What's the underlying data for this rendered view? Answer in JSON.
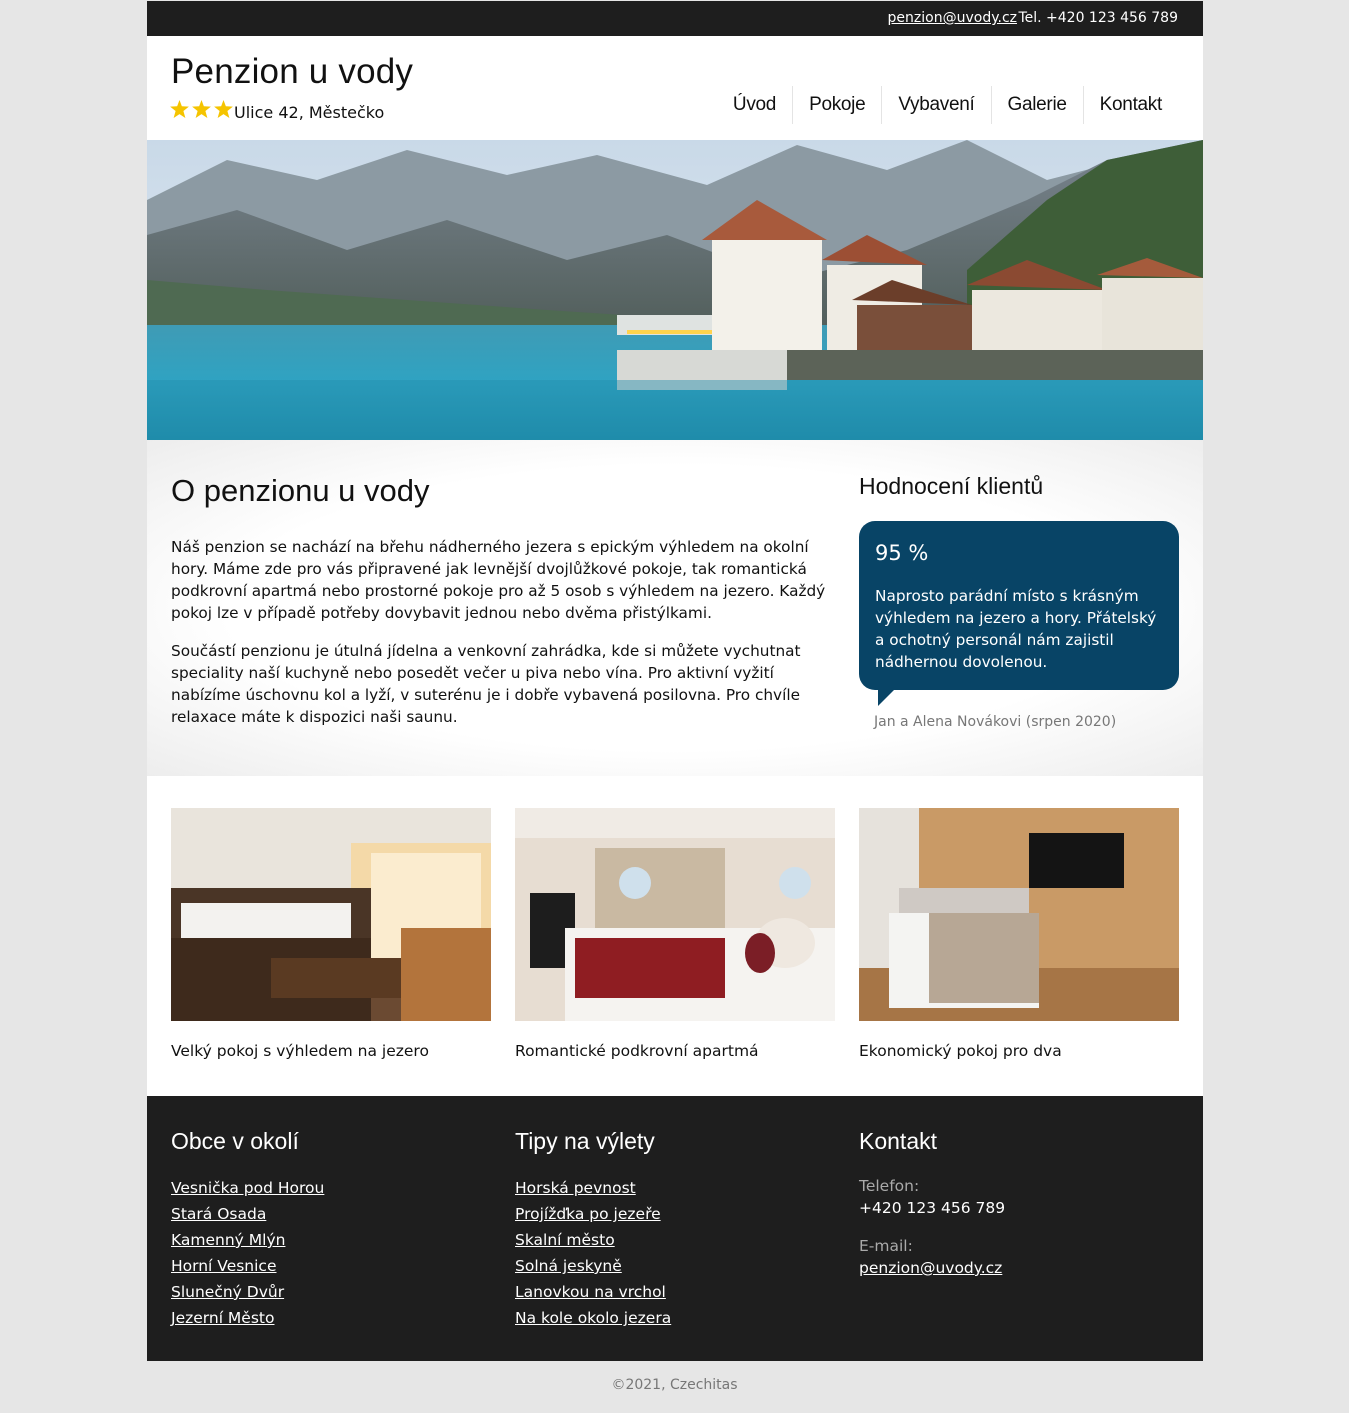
{
  "topbar": {
    "email": "penzion@uvody.cz",
    "phone": "Tel. +420 123 456 789"
  },
  "header": {
    "title": "Penzion u vody",
    "stars": 3,
    "address": "Ulice 42, Městečko"
  },
  "nav": {
    "items": [
      "Úvod",
      "Pokoje",
      "Vybavení",
      "Galerie",
      "Kontakt"
    ]
  },
  "about": {
    "heading": "O penzionu u vody",
    "paragraph1": "Náš penzion se nachází na břehu nádherného jezera s epickým výhledem na okolní hory. Máme zde pro vás připravené jak levnější dvojlůžkové pokoje, tak romantická podkrovní apartmá nebo prostorné pokoje pro až 5 osob s výhledem na jezero. Každý pokoj lze v případě potřeby dovybavit jednou nebo dvěma přistýlkami.",
    "paragraph2": "Součástí penzionu je útulná jídelna a venkovní zahrádka, kde si můžete vychutnat speciality naší kuchyně nebo posedět večer u piva nebo vína. Pro aktivní vyžití nabízíme úschovnu kol a lyží, v suterénu je i dobře vybavená posilovna. Pro chvíle relaxace máte k dispozici naši saunu."
  },
  "reviews": {
    "heading": "Hodnocení klientů",
    "score": "95 %",
    "text": "Naprosto parádní místo s krásným výhledem na jezero a hory. Přátelský a ochotný personál nám zajistil nádhernou dovolenou.",
    "author": "Jan a Alena Novákovi (srpen 2020)"
  },
  "rooms": [
    {
      "caption": "Velký pokoj s výhledem na jezero"
    },
    {
      "caption": "Romantické podkrovní apartmá"
    },
    {
      "caption": "Ekonomický pokoj pro dva"
    }
  ],
  "footer": {
    "villages": {
      "heading": "Obce v okolí",
      "links": [
        "Vesnička pod Horou",
        "Stará Osada",
        "Kamenný Mlýn",
        "Horní Vesnice",
        "Slunečný Dvůr",
        "Jezerní Město"
      ]
    },
    "trips": {
      "heading": "Tipy na výlety",
      "links": [
        "Horská pevnost",
        "Projížďka po jezeře",
        "Skalní město",
        "Solná jeskyně",
        "Lanovkou na vrchol",
        "Na kole okolo jezera"
      ]
    },
    "contact": {
      "heading": "Kontakt",
      "phone_label": "Telefon:",
      "phone": "+420 123 456 789",
      "email_label": "E-mail:",
      "email": "penzion@uvody.cz"
    }
  },
  "copyright": "©2021, Czechitas",
  "colors": {
    "dark_bar": "#1e1e1e",
    "review_bubble": "#084466",
    "star": "#f5c400",
    "page_bg": "#e6e6e6"
  }
}
